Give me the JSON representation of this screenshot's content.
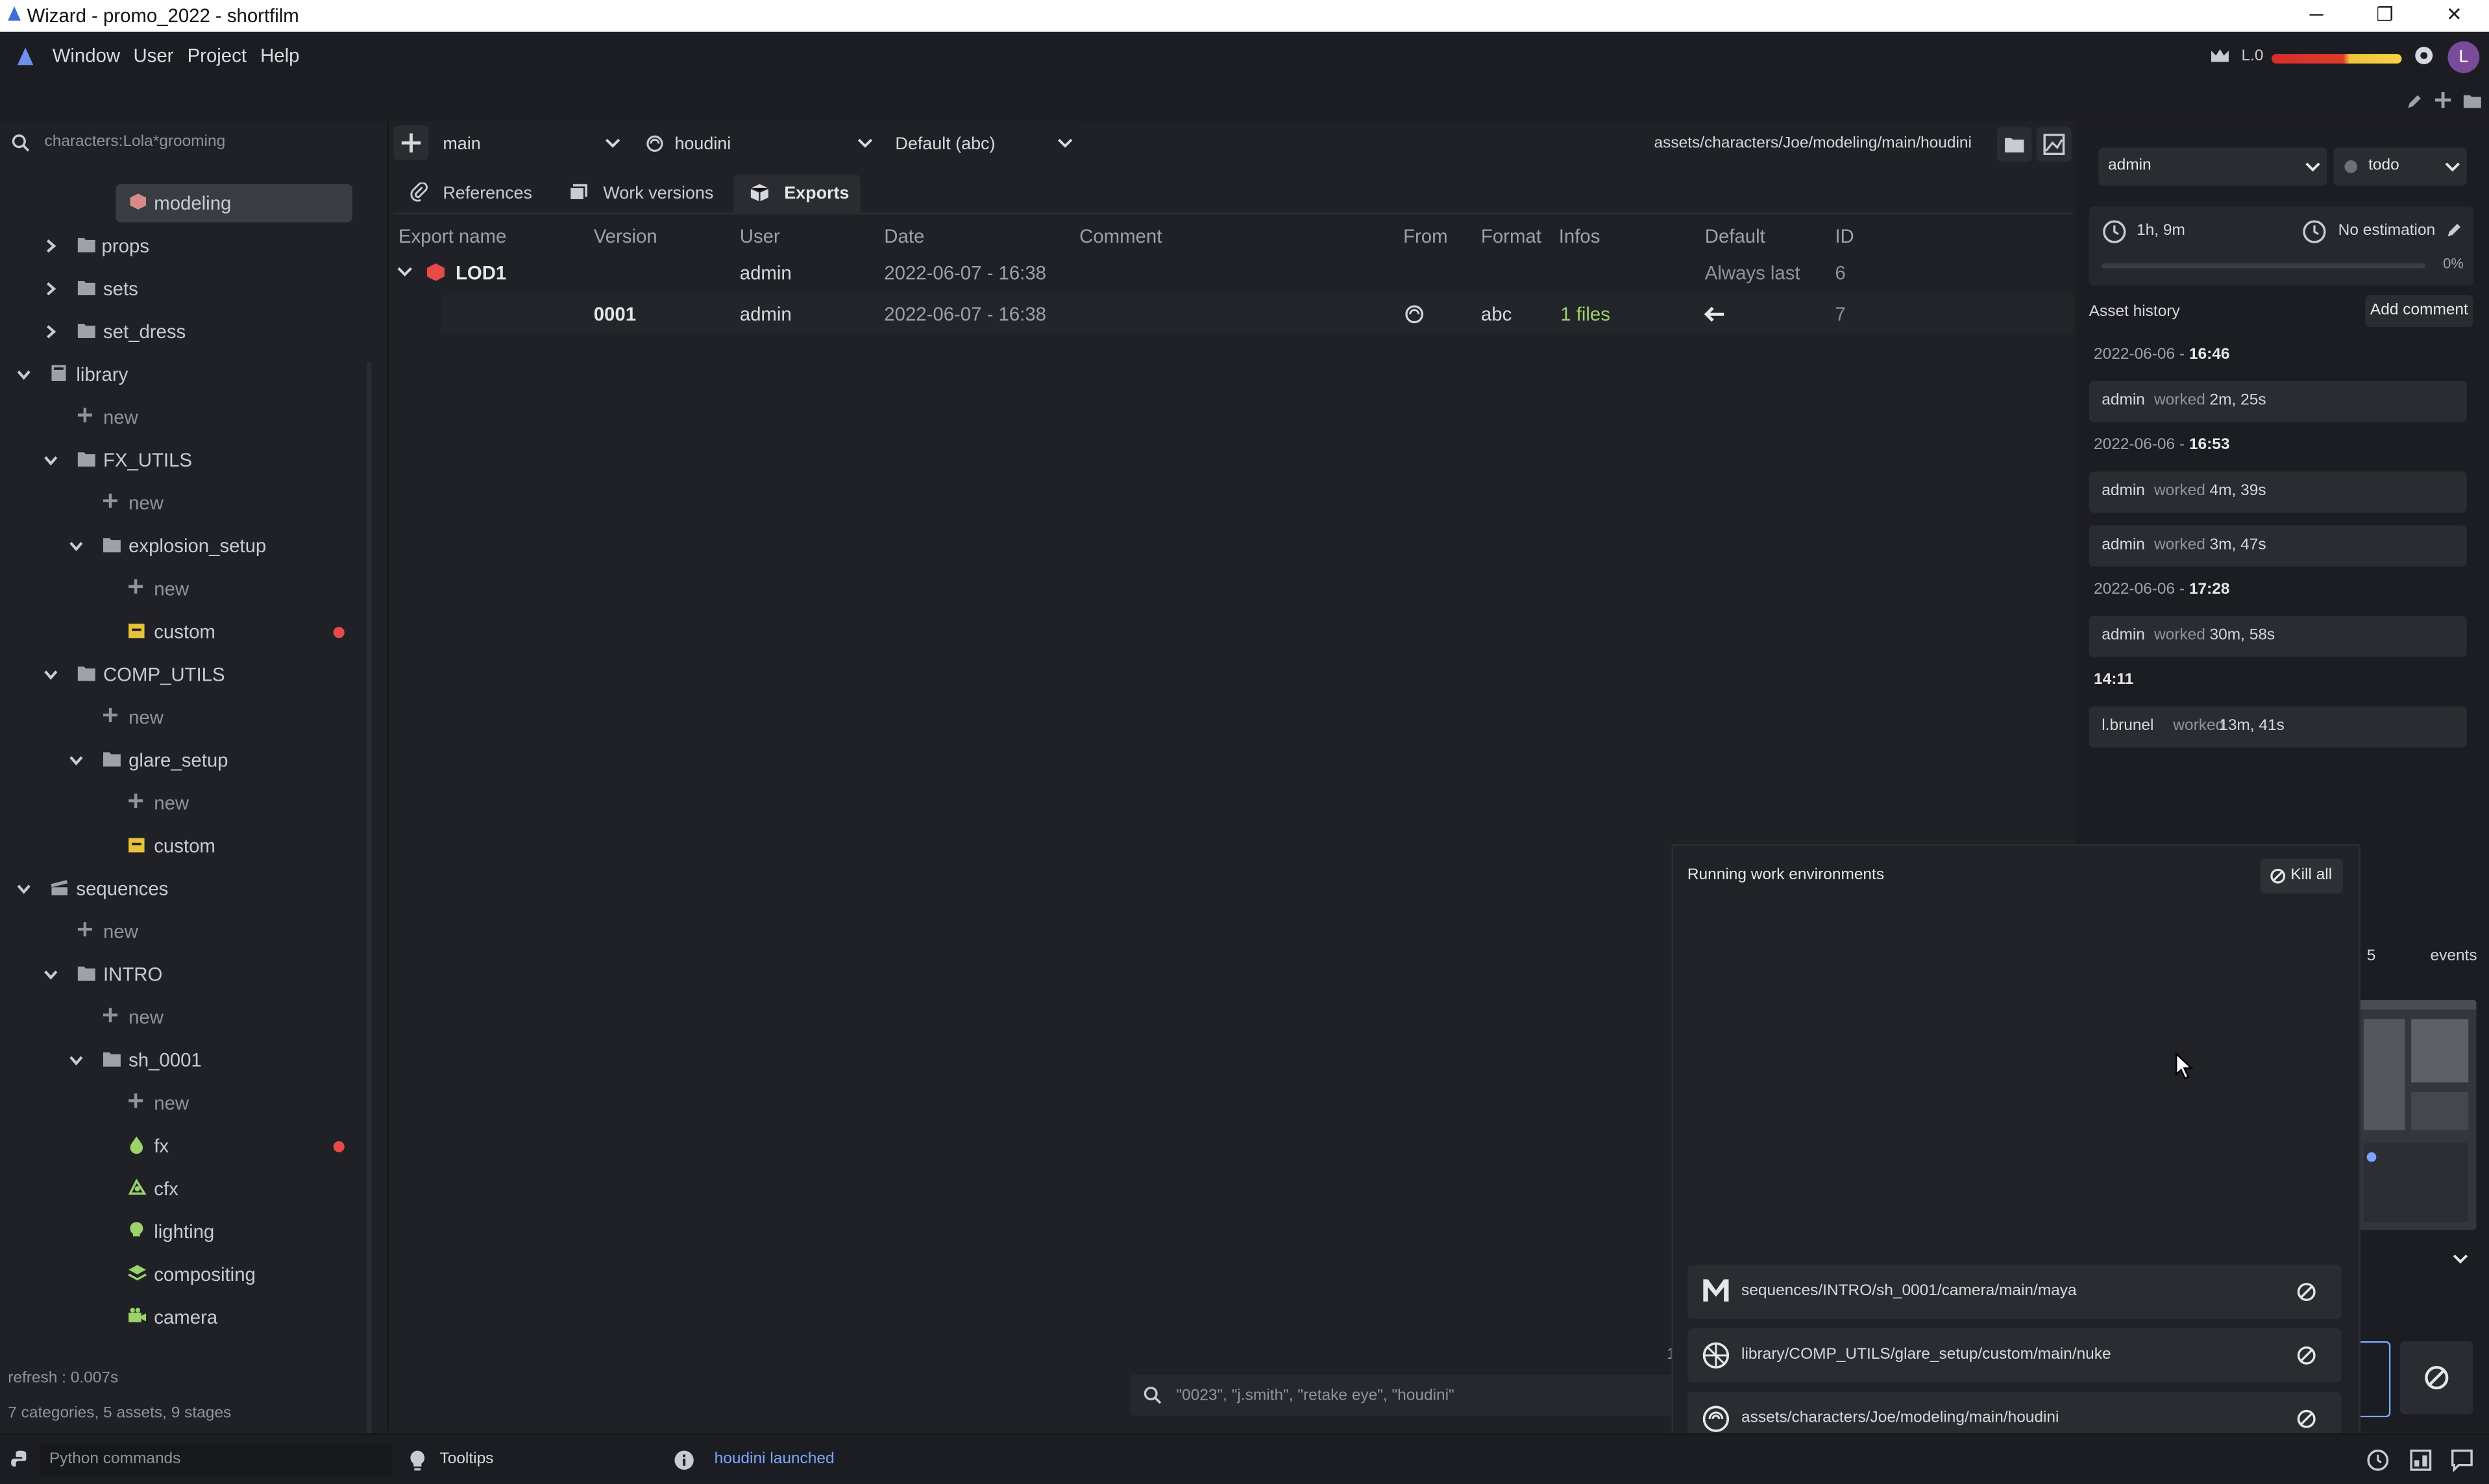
{
  "window": {
    "title": "Wizard - promo_2022 - shortfilm",
    "minimize": "─",
    "maximize": "❐",
    "close": "✕"
  },
  "menu": {
    "items": [
      "Window",
      "User",
      "Project",
      "Help"
    ]
  },
  "topright": {
    "level_label": "L.0",
    "avatar": "L"
  },
  "search": {
    "placeholder": "characters:Lola*grooming"
  },
  "tree": {
    "selected": "modeling",
    "items": [
      {
        "label": "props"
      },
      {
        "label": "sets"
      },
      {
        "label": "set_dress"
      },
      {
        "label": "library"
      },
      {
        "label": "new"
      },
      {
        "label": "FX_UTILS"
      },
      {
        "label": "new"
      },
      {
        "label": "explosion_setup"
      },
      {
        "label": "new"
      },
      {
        "label": "custom"
      },
      {
        "label": "COMP_UTILS"
      },
      {
        "label": "new"
      },
      {
        "label": "glare_setup"
      },
      {
        "label": "new"
      },
      {
        "label": "custom"
      },
      {
        "label": "sequences"
      },
      {
        "label": "new"
      },
      {
        "label": "INTRO"
      },
      {
        "label": "new"
      },
      {
        "label": "sh_0001"
      },
      {
        "label": "new"
      },
      {
        "label": "fx"
      },
      {
        "label": "cfx"
      },
      {
        "label": "lighting"
      },
      {
        "label": "compositing"
      },
      {
        "label": "camera"
      }
    ],
    "refresh": "refresh : 0.007s",
    "summary": "7 categories, 5 assets, 9 stages"
  },
  "center": {
    "variant": "main",
    "software": "houdini",
    "export_format": "Default (abc)",
    "path": "assets/characters/Joe/modeling/main/houdini",
    "tabs": [
      "References",
      "Work versions",
      "Exports"
    ],
    "columns": [
      "Export name",
      "Version",
      "User",
      "Date",
      "Comment",
      "From",
      "Format",
      "Infos",
      "Default",
      "ID"
    ],
    "export_row": {
      "name": "LOD1",
      "user": "admin",
      "date": "2022-06-07 - 16:38",
      "default": "Always last",
      "id": "6"
    },
    "version_row": {
      "version": "0001",
      "user": "admin",
      "date": "2022-06-07 - 16:38",
      "format": "abc",
      "infos": "1 files",
      "id": "7"
    },
    "search_placeholder": "\"0023\", \"j.smith\", \"retake eye\", \"houdini\"",
    "left_clip": "1"
  },
  "right": {
    "user": "admin",
    "state": "todo",
    "work_time": "1h, 9m",
    "estimation": "No estimation",
    "progress": "0%",
    "history_title": "Asset history",
    "add_comment": "Add comment",
    "history": [
      {
        "date": "2022-06-06 - ",
        "time": "16:46"
      },
      {
        "user": "admin",
        "verb": "worked",
        "amount": "2m, 25s"
      },
      {
        "date": "2022-06-06 - ",
        "time": "16:53"
      },
      {
        "user": "admin",
        "verb": "worked",
        "amount": "4m, 39s"
      },
      {
        "user": "admin",
        "verb": "worked",
        "amount": "3m, 47s"
      },
      {
        "date": "2022-06-06 - ",
        "time": "17:28"
      },
      {
        "user": "admin",
        "verb": "worked",
        "amount": "30m, 58s"
      },
      {
        "date": "",
        "time": "14:11"
      },
      {
        "user": "l.brunel",
        "verb": "worked",
        "amount": "13m, 41s"
      }
    ],
    "events_count": "5",
    "events_label": "events"
  },
  "popup": {
    "title": "Running work environments",
    "kill_all": "Kill all",
    "envs": [
      {
        "path": "sequences/INTRO/sh_0001/camera/main/maya"
      },
      {
        "path": "library/COMP_UTILS/glare_setup/custom/main/nuke"
      },
      {
        "path": "assets/characters/Joe/modeling/main/houdini"
      }
    ]
  },
  "status": {
    "python_placeholder": "Python commands",
    "tooltips": "Tooltips",
    "message": "houdini launched"
  },
  "colors": {
    "accent": "#7aa7ff",
    "red": "#e84a4a",
    "green": "#9bd36a",
    "bg": "#1f2126"
  }
}
